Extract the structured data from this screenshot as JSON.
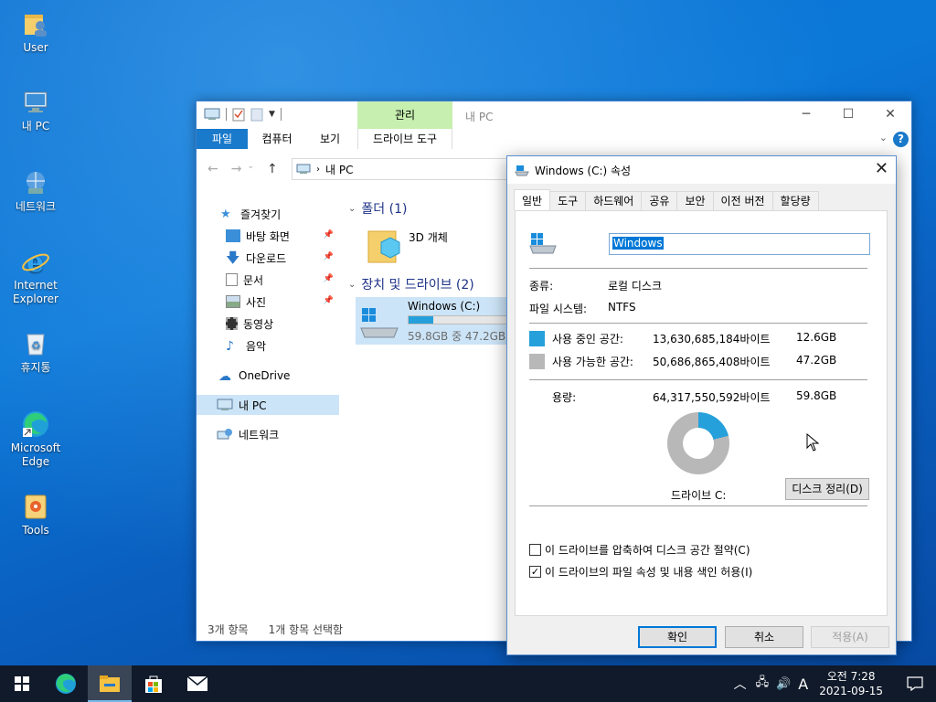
{
  "desktop": {
    "icons": [
      {
        "label": "User"
      },
      {
        "label": "내 PC"
      },
      {
        "label": "네트워크"
      },
      {
        "label": "Internet Explorer"
      },
      {
        "label": "휴지통"
      },
      {
        "label": "Microsoft Edge"
      },
      {
        "label": "Tools"
      }
    ]
  },
  "explorer": {
    "manage_tab": "관리",
    "title": "내 PC",
    "ribbon_tabs": [
      "파일",
      "컴퓨터",
      "보기",
      "드라이브 도구"
    ],
    "address": "내 PC",
    "nav": {
      "quick_access": "즐겨찾기",
      "items": [
        "바탕 화면",
        "다운로드",
        "문서",
        "사진",
        "동영상",
        "음악"
      ],
      "onedrive": "OneDrive",
      "this_pc": "내 PC",
      "network": "네트워크"
    },
    "groups": {
      "folders": "폴더 (1)",
      "folder_item": "3D 개체",
      "drives": "장치 및 드라이브 (2)",
      "drive_name": "Windows (C:)",
      "drive_usage": "59.8GB 중 47.2GB 사"
    },
    "drive_used_fraction": 0.21,
    "status": {
      "count": "3개 항목",
      "selected": "1개 항목 선택함"
    }
  },
  "dialog": {
    "title": "Windows (C:) 속성",
    "tabs": [
      "일반",
      "도구",
      "하드웨어",
      "공유",
      "보안",
      "이전 버전",
      "할당량"
    ],
    "name_value": "Windows",
    "type_label": "종류:",
    "type_value": "로컬 디스크",
    "fs_label": "파일 시스템:",
    "fs_value": "NTFS",
    "used_label": "사용 중인 공간:",
    "used_bytes": "13,630,685,184바이트",
    "used_gb": "12.6GB",
    "free_label": "사용 가능한 공간:",
    "free_bytes": "50,686,865,408바이트",
    "free_gb": "47.2GB",
    "cap_label": "용량:",
    "cap_bytes": "64,317,550,592바이트",
    "cap_gb": "59.8GB",
    "drive_label": "드라이브 C:",
    "cleanup_label": "디스크 정리(D)",
    "compress_label": "이 드라이브를 압축하여 디스크 공간 절약(C)",
    "compress_checked": false,
    "index_label": "이 드라이브의 파일 속성 및 내용 색인 허용(I)",
    "index_checked": true,
    "ok_label": "확인",
    "cancel_label": "취소",
    "apply_label": "적용(A)",
    "used_color": "#26a0da",
    "free_color": "#b8b8b8",
    "used_fraction": 0.212
  },
  "taskbar": {
    "ime": "A",
    "time": "오전 7:28",
    "date": "2021-09-15"
  }
}
